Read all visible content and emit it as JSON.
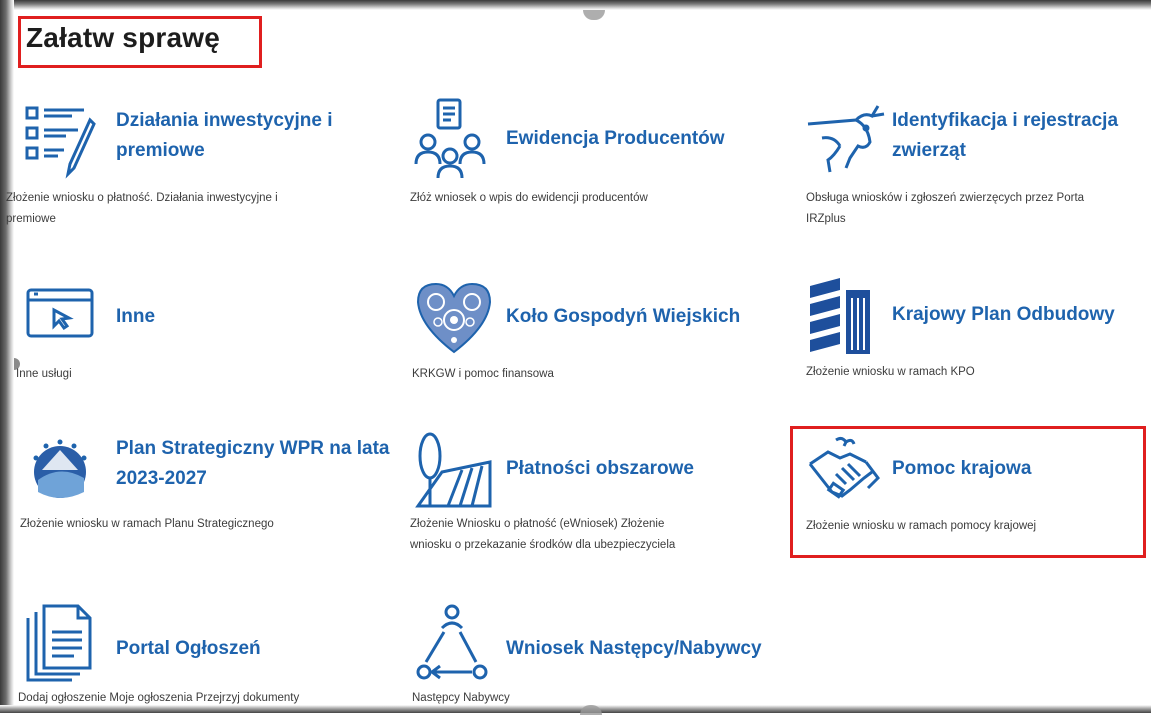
{
  "page": {
    "title": "Załatw sprawę"
  },
  "colors": {
    "accent": "#1e63ad",
    "highlight": "#e01f1f",
    "text": "#3c3c3c"
  },
  "cards": [
    {
      "title_line1": "Działania inwestycyjne i",
      "title_line2": "premiowe",
      "desc_line1": "Złożenie wniosku o płatność. Działania inwestycyjne i",
      "desc_line2": "premiowe",
      "icon": "checklist-pen-icon"
    },
    {
      "title_line1": "Ewidencja Producentów",
      "title_line2": "",
      "desc_line1": "Złóż wniosek o wpis do ewidencji producentów",
      "desc_line2": "",
      "icon": "people-document-icon"
    },
    {
      "title_line1": "Identyfikacja i rejestracja",
      "title_line2": "zwierząt",
      "desc_line1": "Obsługa wniosków i zgłoszeń zwierzęcych przez Porta",
      "desc_line2": "IRZplus",
      "icon": "cow-icon"
    },
    {
      "title_line1": "Inne",
      "title_line2": "",
      "desc_line1": "Inne usługi",
      "desc_line2": "",
      "icon": "monitor-cursor-icon"
    },
    {
      "title_line1": "Koło Gospodyń Wiejskich",
      "title_line2": "",
      "desc_line1": "KRKGW i pomoc finansowa",
      "desc_line2": "",
      "icon": "folk-heart-icon"
    },
    {
      "title_line1": "Krajowy Plan Odbudowy",
      "title_line2": "",
      "desc_line1": "Złożenie wniosku w ramach KPO",
      "desc_line2": "",
      "icon": "kpo-building-icon"
    },
    {
      "title_line1": "Plan Strategiczny WPR na lata",
      "title_line2": "2023-2027",
      "desc_line1": "Złożenie wniosku w ramach Planu Strategicznego",
      "desc_line2": "",
      "icon": "wpr-emblem-icon"
    },
    {
      "title_line1": "Płatności obszarowe",
      "title_line2": "",
      "desc_line1": "Złożenie Wniosku o płatność (eWniosek) Złożenie",
      "desc_line2": "wniosku o przekazanie środków dla ubezpieczyciela",
      "icon": "field-tree-icon"
    },
    {
      "title_line1": "Pomoc krajowa",
      "title_line2": "",
      "desc_line1": "Złożenie wniosku w ramach pomocy krajowej",
      "desc_line2": "",
      "icon": "handshake-icon"
    },
    {
      "title_line1": "Portal Ogłoszeń",
      "title_line2": "",
      "desc_line1": "Dodaj ogłoszenie Moje ogłoszenia Przejrzyj dokumenty",
      "desc_line2": "",
      "icon": "documents-stack-icon"
    },
    {
      "title_line1": "Wniosek Następcy/Nabywcy",
      "title_line2": "",
      "desc_line1": "Następcy Nabywcy",
      "desc_line2": "",
      "icon": "person-cycle-icon"
    }
  ]
}
